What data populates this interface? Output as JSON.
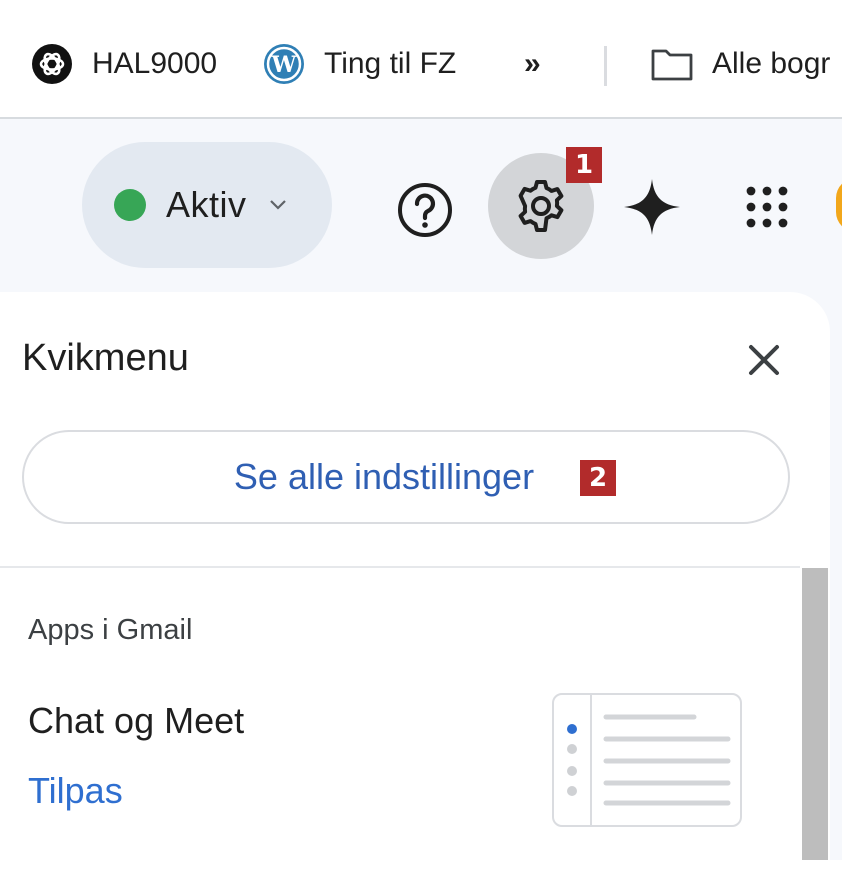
{
  "bookmarks": {
    "items": [
      {
        "label": "HAL9000",
        "icon": "openai-logo-icon"
      },
      {
        "label": "Ting til FZ",
        "icon": "wordpress-logo-icon"
      }
    ],
    "overflow_label": "»",
    "folder": {
      "label": "Alle bogr",
      "icon": "folder-icon"
    }
  },
  "header": {
    "status": {
      "label": "Aktiv",
      "dot_color": "#37a656",
      "icon": "chevron-down-icon"
    },
    "icons": [
      "help-icon",
      "gear-icon",
      "sparkle-icon",
      "apps-grid-icon"
    ]
  },
  "badges": {
    "one": "1",
    "two": "2"
  },
  "quick_settings": {
    "title": "Kvikmenu",
    "close_icon": "close-icon",
    "all_settings_label": "Se alle indstillinger",
    "section_title": "Apps i Gmail",
    "chat_title": "Chat og Meet",
    "customize_label": "Tilpas"
  },
  "colors": {
    "accent_blue": "#2f6fd0",
    "badge_red": "#b22b2b",
    "status_green": "#37a656"
  }
}
